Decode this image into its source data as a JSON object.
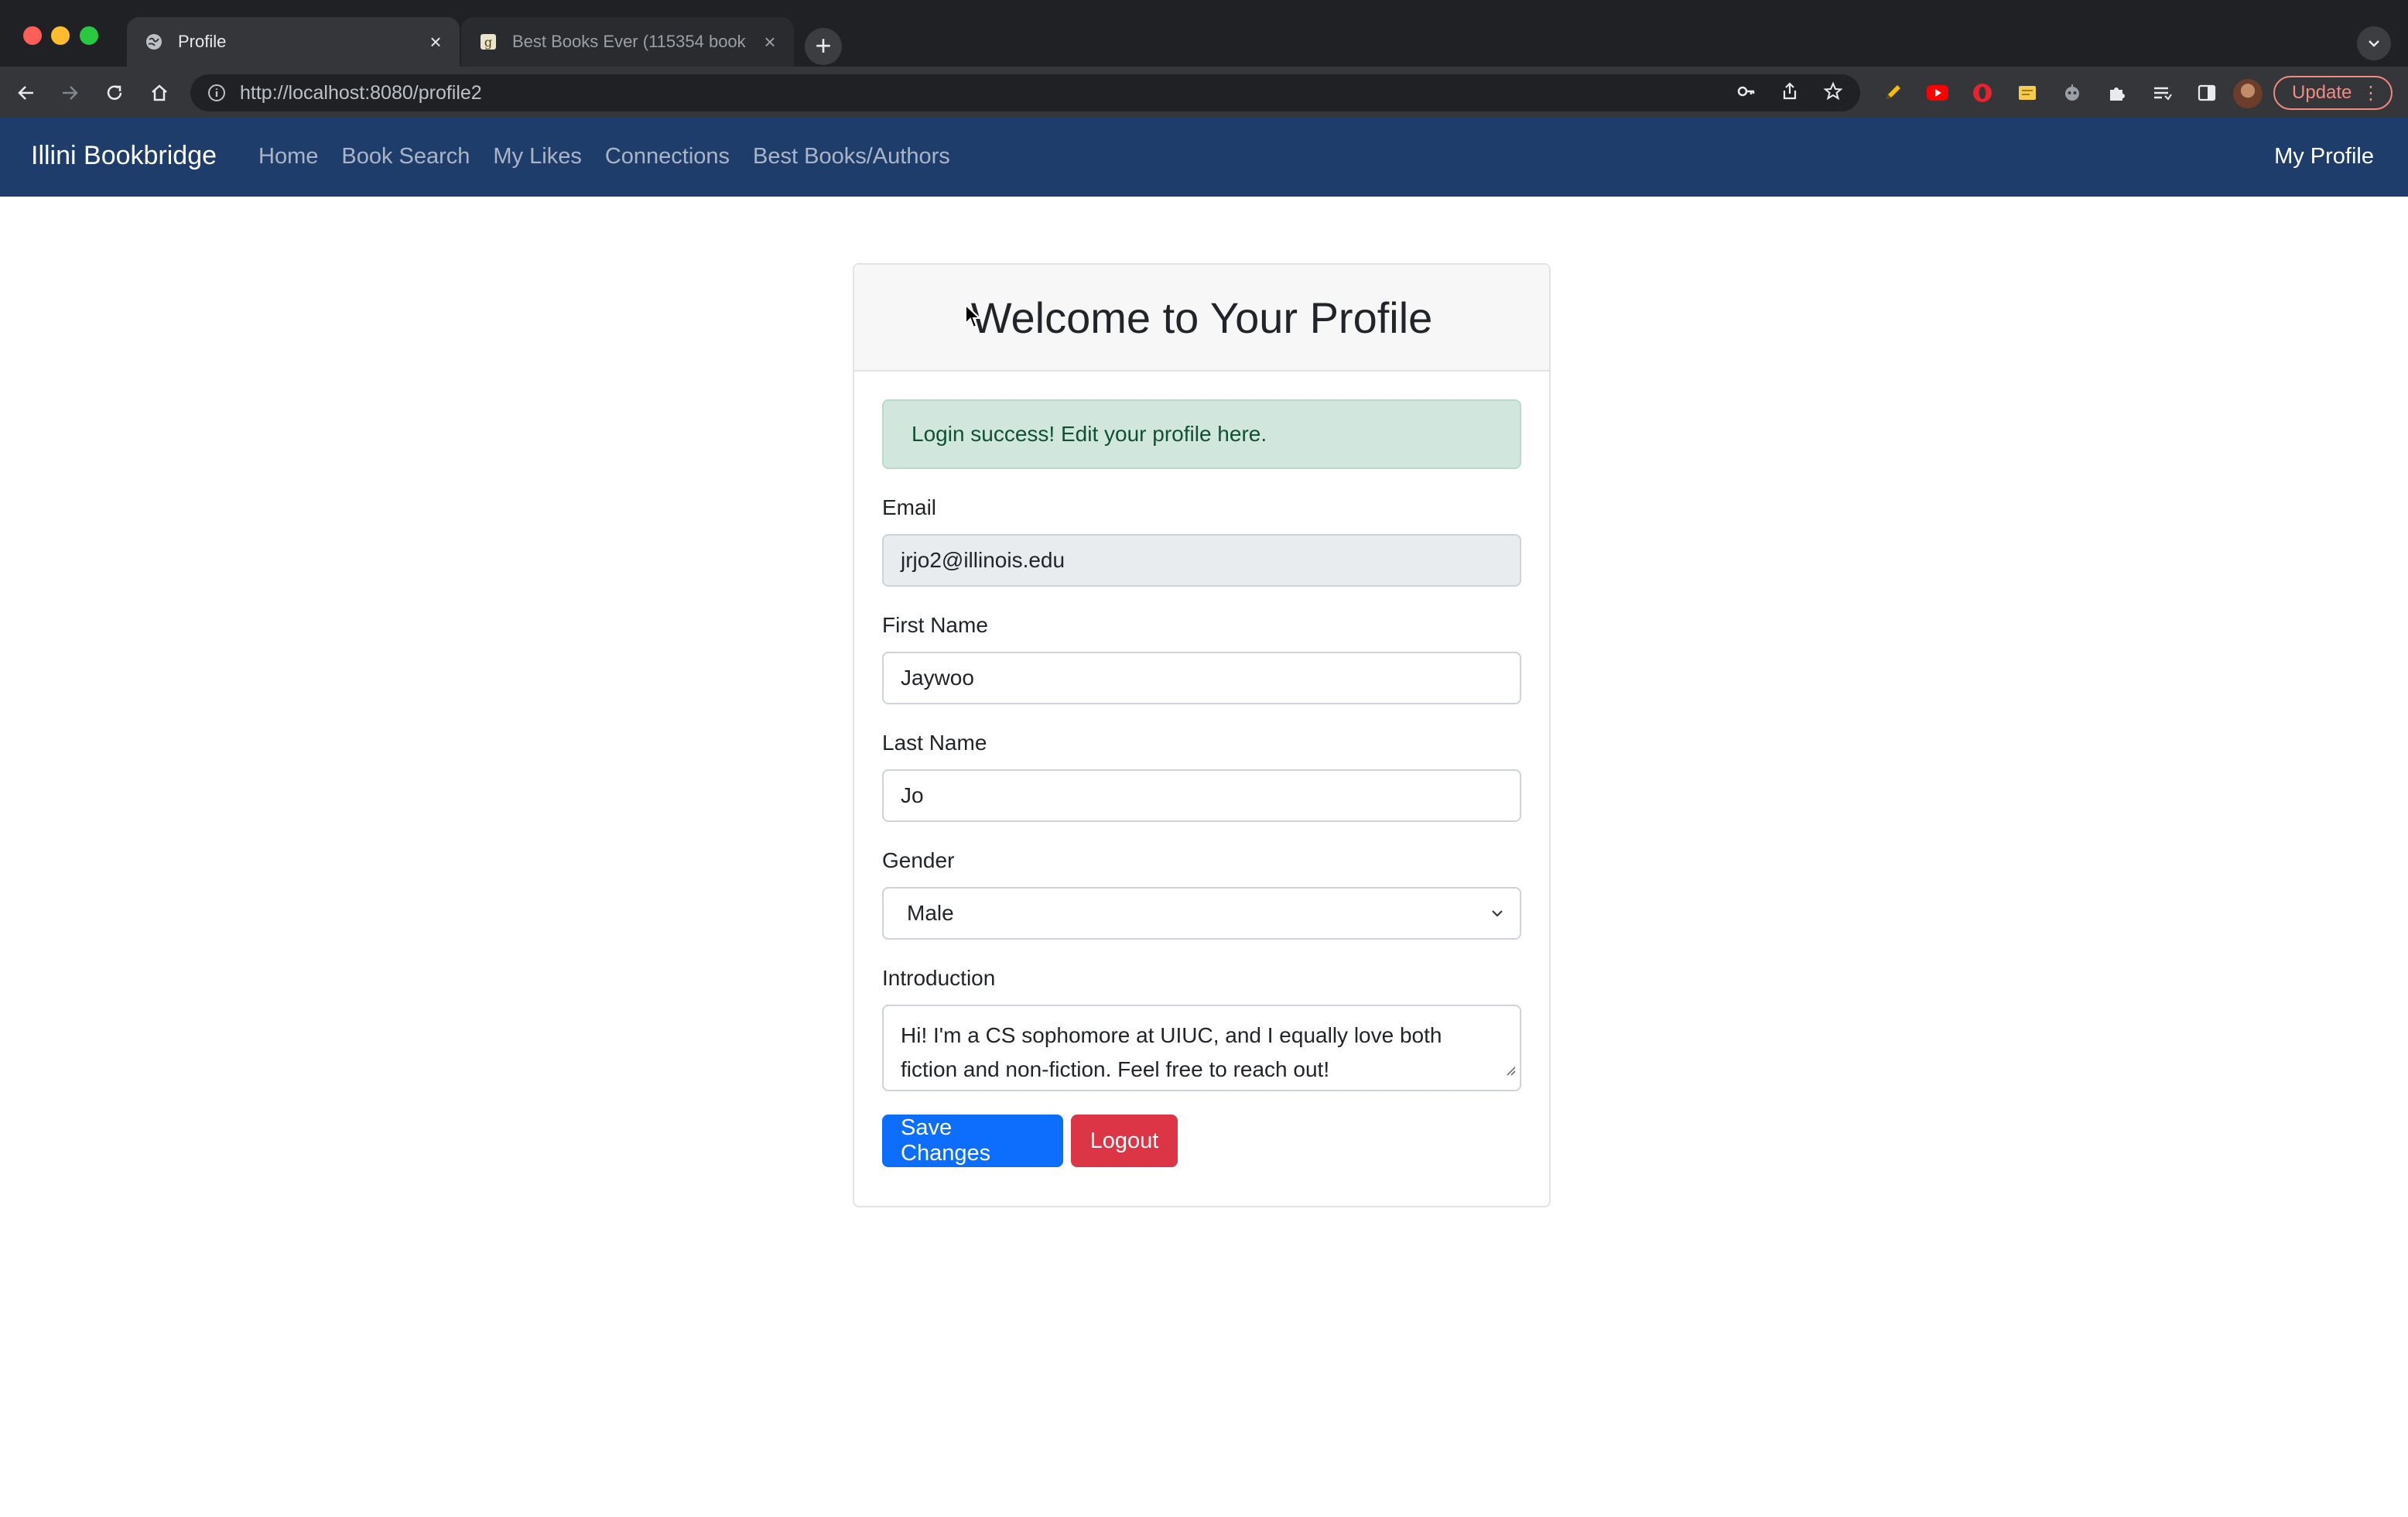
{
  "browser": {
    "tabs": [
      {
        "title": "Profile",
        "active": true,
        "icon": "globe-icon"
      },
      {
        "title": "Best Books Ever (115354 book",
        "active": false,
        "icon": "goodreads-icon"
      }
    ],
    "url": "http://localhost:8080/profile2",
    "update_label": "Update"
  },
  "navbar": {
    "brand": "Illini Bookbridge",
    "links": [
      "Home",
      "Book Search",
      "My Likes",
      "Connections",
      "Best Books/Authors"
    ],
    "profile_link": "My Profile",
    "color": "#1f3d6b"
  },
  "profile": {
    "heading": "Welcome to Your Profile",
    "alert": "Login success! Edit your profile here.",
    "email_label": "Email",
    "email_value": "jrjo2@illinois.edu",
    "first_name_label": "First Name",
    "first_name_value": "Jaywoo",
    "last_name_label": "Last Name",
    "last_name_value": "Jo",
    "gender_label": "Gender",
    "gender_value": "Male",
    "intro_label": "Introduction",
    "intro_line1": "Hi! I'm a CS sophomore at UIUC, and I equally love both",
    "intro_line2": "fiction and non-fiction. Feel free to reach out!",
    "save_label": "Save Changes",
    "logout_label": "Logout"
  },
  "colors": {
    "primary": "#0d6efd",
    "danger": "#dc3545",
    "success_bg": "#d1e7dd"
  }
}
